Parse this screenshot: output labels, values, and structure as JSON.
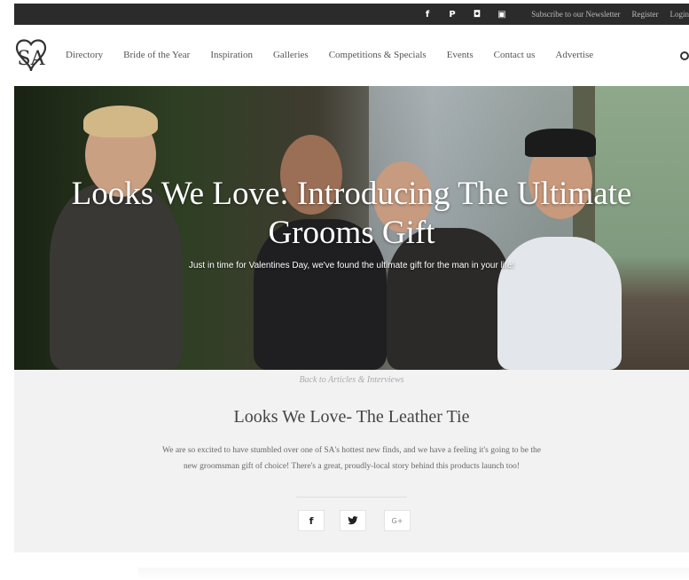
{
  "topbar": {
    "social_icons": [
      "facebook-icon",
      "pinterest-icon",
      "instagram-icon",
      "youtube-icon"
    ],
    "social_glyphs": [
      "f",
      "P",
      "◘",
      "▣"
    ],
    "newsletter_label": "Subscribe to our Newsletter",
    "register_label": "Register",
    "login_label": "Login"
  },
  "header": {
    "logo_text": "SA",
    "nav": [
      "Directory",
      "Bride of the Year",
      "Inspiration",
      "Galleries",
      "Competitions & Specials",
      "Events",
      "Contact us",
      "Advertise"
    ]
  },
  "hero": {
    "title_line1": "Looks We Love: Introducing The Ultimate",
    "title_line2": "Grooms Gift",
    "subtitle": "Just in time for Valentines Day, we've found the ultimate gift for the man in your life!"
  },
  "article": {
    "back_link": "Back to Articles & Interviews",
    "title": "Looks We Love- The Leather Tie",
    "intro_line1": "We are so excited to have stumbled over one of SA's hottest new finds, and we have a feeling it's going to be the",
    "intro_line2": "new groomsman gift of choice! There's a great, proudly-local story behind this products launch too!"
  },
  "share": {
    "facebook": "f",
    "twitter": "🐦",
    "gplus": "G+"
  },
  "colors": {
    "topbar_bg": "#2b2b2b",
    "content_bg": "#f2f2f2",
    "hero_text": "#ffffff"
  }
}
